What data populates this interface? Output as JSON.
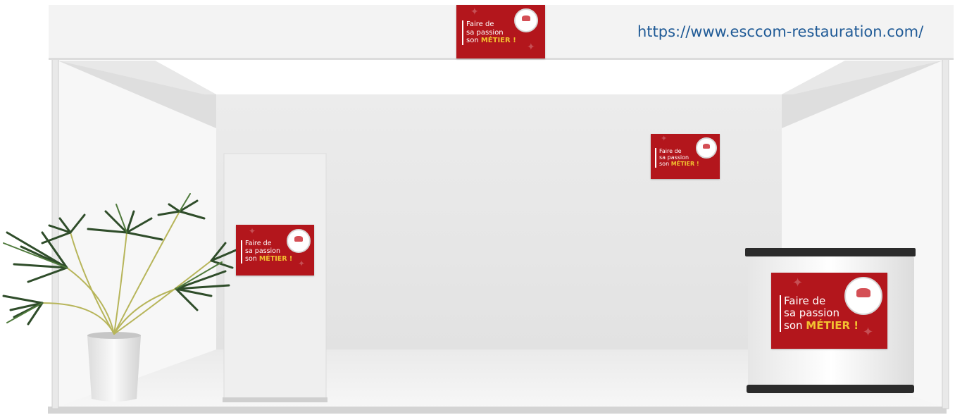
{
  "website_url": "https://www.esccom-restauration.com/",
  "poster": {
    "line1": "Faire de",
    "line2": "sa passion",
    "line3_prefix": "son ",
    "line3_highlight": "MÉTIER !"
  },
  "colors": {
    "poster_red": "#b3161c",
    "highlight_yellow": "#f2c230",
    "url_blue": "#1f5a96",
    "booth_white": "#f2f2f2"
  }
}
